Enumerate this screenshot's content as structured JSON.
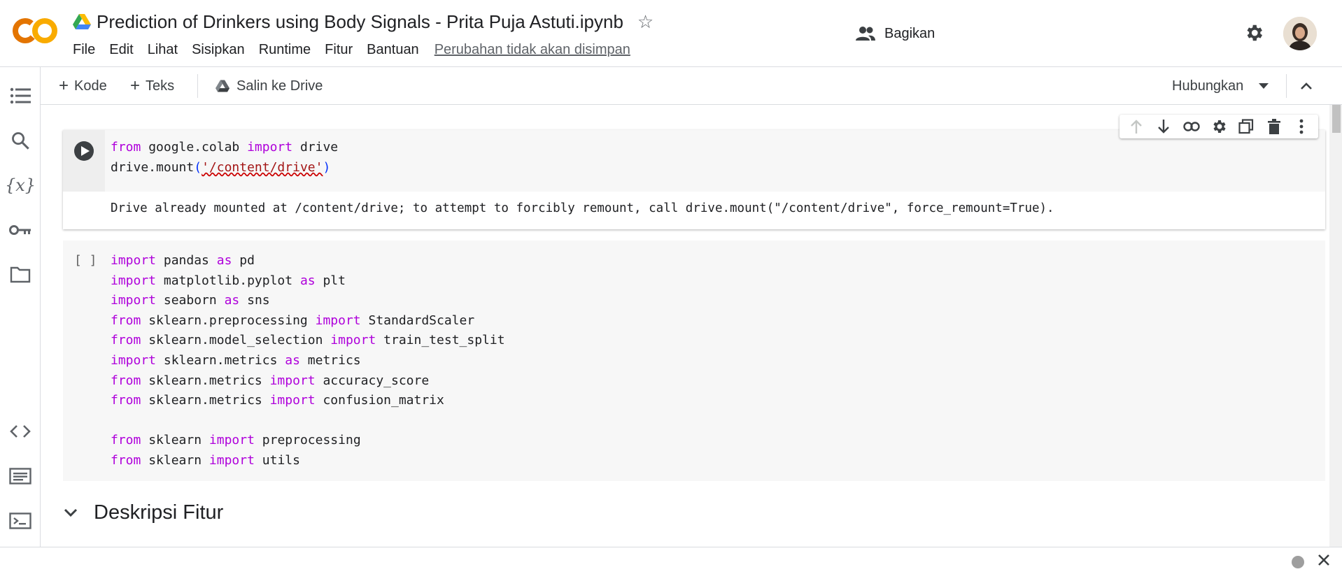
{
  "app": {
    "logo_text": "CO",
    "title": "Prediction of Drinkers using Body Signals - Prita Puja Astuti.ipynb",
    "menu": [
      "File",
      "Edit",
      "Lihat",
      "Sisipkan",
      "Runtime",
      "Fitur",
      "Bantuan"
    ],
    "unsaved_notice": "Perubahan tidak akan disimpan",
    "share_label": "Bagikan"
  },
  "toolbar": {
    "add_code": "Kode",
    "add_text": "Teks",
    "copy_to_drive": "Salin ke Drive",
    "connect": "Hubungkan"
  },
  "sidebar": {
    "icons": [
      "table-of-contents-icon",
      "search-icon",
      "variables-icon",
      "secrets-key-icon",
      "files-folder-icon",
      "code-snippets-icon",
      "command-palette-icon",
      "terminal-icon"
    ]
  },
  "cells": {
    "cell1": {
      "lines": [
        [
          [
            "kw",
            "from"
          ],
          [
            "",
            " google.colab "
          ],
          [
            "kw",
            "import"
          ],
          [
            "",
            " drive"
          ]
        ],
        [
          [
            "",
            "drive.mount"
          ],
          [
            "paren",
            "("
          ],
          [
            "str",
            "'/content/drive'"
          ],
          [
            "paren",
            ")"
          ]
        ]
      ],
      "output": "Drive already mounted at /content/drive; to attempt to forcibly remount, call drive.mount(\"/content/drive\", force_remount=True)."
    },
    "cell2": {
      "exec_marker": "[ ]",
      "lines": [
        [
          [
            "kw",
            "import"
          ],
          [
            "",
            " pandas "
          ],
          [
            "kw",
            "as"
          ],
          [
            "",
            " pd"
          ]
        ],
        [
          [
            "kw",
            "import"
          ],
          [
            "",
            " matplotlib.pyplot "
          ],
          [
            "kw",
            "as"
          ],
          [
            "",
            " plt"
          ]
        ],
        [
          [
            "kw",
            "import"
          ],
          [
            "",
            " seaborn "
          ],
          [
            "kw",
            "as"
          ],
          [
            "",
            " sns"
          ]
        ],
        [
          [
            "kw",
            "from"
          ],
          [
            "",
            " sklearn.preprocessing "
          ],
          [
            "kw",
            "import"
          ],
          [
            "",
            " StandardScaler"
          ]
        ],
        [
          [
            "kw",
            "from"
          ],
          [
            "",
            " sklearn.model_selection "
          ],
          [
            "kw",
            "import"
          ],
          [
            "",
            " train_test_split"
          ]
        ],
        [
          [
            "kw",
            "import"
          ],
          [
            "",
            " sklearn.metrics "
          ],
          [
            "kw",
            "as"
          ],
          [
            "",
            " metrics"
          ]
        ],
        [
          [
            "kw",
            "from"
          ],
          [
            "",
            " sklearn.metrics "
          ],
          [
            "kw",
            "import"
          ],
          [
            "",
            " accuracy_score"
          ]
        ],
        [
          [
            "kw",
            "from"
          ],
          [
            "",
            " sklearn.metrics "
          ],
          [
            "kw",
            "import"
          ],
          [
            "",
            " confusion_matrix"
          ]
        ],
        [],
        [
          [
            "kw",
            "from"
          ],
          [
            "",
            " sklearn "
          ],
          [
            "kw",
            "import"
          ],
          [
            "",
            " preprocessing"
          ]
        ],
        [
          [
            "kw",
            "from"
          ],
          [
            "",
            " sklearn "
          ],
          [
            "kw",
            "import"
          ],
          [
            "",
            " utils"
          ]
        ]
      ]
    }
  },
  "section": {
    "title": "Deskripsi Fitur"
  },
  "colors": {
    "keyword": "#af00db",
    "string": "#a31515",
    "accent_logo_orange": "#f9ab00",
    "accent_logo_dark": "#e37400"
  }
}
